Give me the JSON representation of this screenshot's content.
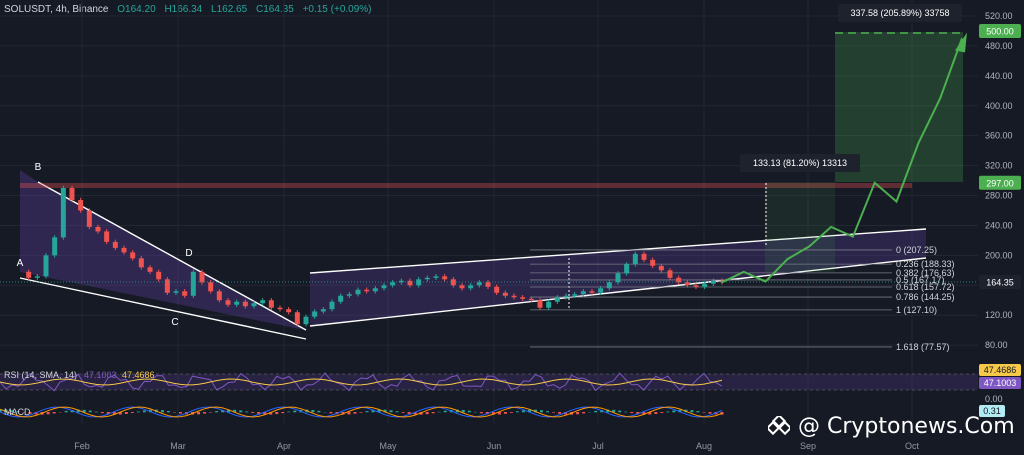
{
  "header": {
    "symbol": "SOLUSDT, 4h, Binance",
    "open": "O164.20",
    "high": "H166.34",
    "low": "L162.65",
    "close": "C164.35",
    "change": "+0.15 (+0.09%)"
  },
  "watermark": "@ Cryptonews.Com",
  "colors": {
    "background": "#161a25",
    "up": "#26a69a",
    "down": "#ef5350",
    "target": "#4caf50",
    "rsi": "#7e57c2",
    "rsi_ma": "#f7c948"
  },
  "chart_data": {
    "type": "line",
    "title": "",
    "symbol": "SOLUSDT",
    "timeframe": "4h",
    "exchange": "Binance",
    "x_ticks": [
      "Feb",
      "Mar",
      "Apr",
      "May",
      "Jun",
      "Jul",
      "Aug",
      "Sep",
      "Oct"
    ],
    "y_ticks": [
      80,
      120,
      160,
      200,
      240,
      280,
      320,
      360,
      400,
      440,
      480,
      520
    ],
    "ylim": [
      60,
      530
    ],
    "grid": true,
    "series": [
      {
        "values": [
          178,
          170,
          172,
          200,
          224,
          290,
          274,
          260,
          238,
          232,
          218,
          210,
          204,
          196,
          184,
          178,
          168,
          150,
          152,
          146,
          178,
          164,
          152,
          140,
          134,
          138,
          132,
          136,
          140,
          130,
          128,
          124,
          108,
          118,
          125,
          128,
          138,
          146,
          148,
          154,
          152,
          156,
          160,
          164,
          166,
          160,
          168,
          170,
          172,
          168,
          160,
          156,
          160,
          164,
          158,
          150,
          146,
          144,
          142,
          140,
          130,
          138,
          144,
          146,
          148,
          152,
          150,
          156,
          164,
          176,
          188,
          202,
          194,
          186,
          180,
          170,
          164,
          160,
          158,
          162,
          166,
          164
        ]
      },
      {
        "name": "projection",
        "values": [
          164,
          178,
          165,
          195,
          212,
          238,
          225,
          297,
          272,
          350,
          410,
          490
        ]
      }
    ],
    "levels": [
      {
        "label": "297.00",
        "value": 297
      },
      {
        "label": "500.00",
        "value": 500
      },
      {
        "label": "164.35",
        "value": 164.35
      }
    ],
    "fibonacci": [
      {
        "ratio": "0",
        "label": "0 (207.25)",
        "value": 207.25
      },
      {
        "ratio": "0.236",
        "label": "0.236 (188.33)",
        "value": 188.33
      },
      {
        "ratio": "0.382",
        "label": "0.382 (176.63)",
        "value": 176.63
      },
      {
        "ratio": "0.5",
        "label": "0.5 (167.17)",
        "value": 167.17
      },
      {
        "ratio": "0.618",
        "label": "0.618 (157.72)",
        "value": 157.72
      },
      {
        "ratio": "0.786",
        "label": "0.786 (144.25)",
        "value": 144.25
      },
      {
        "ratio": "1",
        "label": "1 (127.10)",
        "value": 127.1
      },
      {
        "ratio": "1.618",
        "label": "1.618 (77.57)",
        "value": 77.57
      }
    ],
    "annotations": {
      "points": [
        "A",
        "B",
        "C",
        "D"
      ],
      "measure_1": "133.13 (81.20%) 13313",
      "measure_2": "337.58 (205.89%) 33758"
    },
    "rsi": {
      "label": "RSI (14, SMA, 14)",
      "rsi_value": "47.1003",
      "ma_value": "47.4686",
      "scale_labels": [
        "47.4686",
        "47.1003"
      ]
    },
    "macd": {
      "label": "MACD",
      "scale_labels": [
        "0.00",
        "0.31"
      ]
    }
  }
}
